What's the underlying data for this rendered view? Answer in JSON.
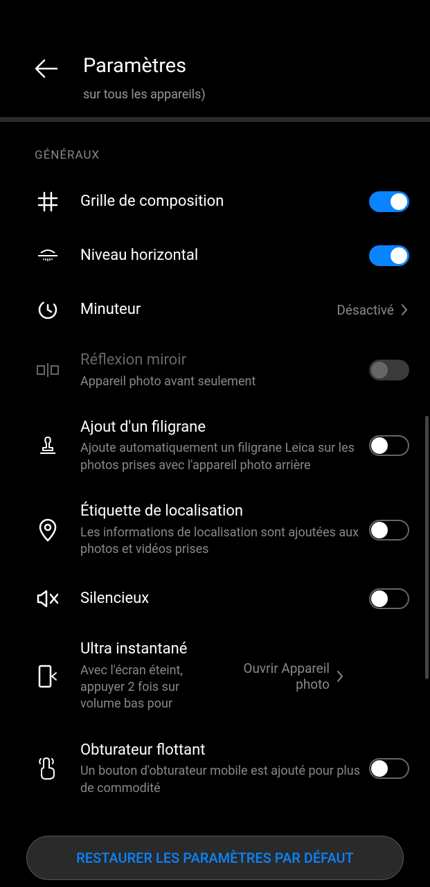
{
  "header": {
    "title": "Paramètres",
    "subtitle": "sur tous les appareils)"
  },
  "section": "GÉNÉRAUX",
  "settings": {
    "grid": {
      "title": "Grille de composition",
      "enabled": true
    },
    "level": {
      "title": "Niveau horizontal",
      "enabled": true
    },
    "timer": {
      "title": "Minuteur",
      "value": "Désactivé"
    },
    "mirror": {
      "title": "Réflexion miroir",
      "description": "Appareil photo avant seulement",
      "disabled": true
    },
    "watermark": {
      "title": "Ajout d'un filigrane",
      "description": "Ajoute automatiquement un filigrane Leica sur les photos prises avec l'appareil photo arrière",
      "enabled": false
    },
    "location": {
      "title": "Étiquette de localisation",
      "description": "Les informations de localisation sont ajoutées aux photos et vidéos prises",
      "enabled": false
    },
    "mute": {
      "title": "Silencieux",
      "enabled": false
    },
    "ultra": {
      "title": "Ultra instantané",
      "description": "Avec l'écran éteint, appuyer 2 fois sur volume bas pour",
      "value": "Ouvrir Appareil photo"
    },
    "floating": {
      "title": "Obturateur flottant",
      "description": "Un bouton d'obturateur mobile est ajouté pour plus de commodité",
      "enabled": false
    }
  },
  "restore": "RESTAURER LES PARAMÈTRES PAR DÉFAUT"
}
